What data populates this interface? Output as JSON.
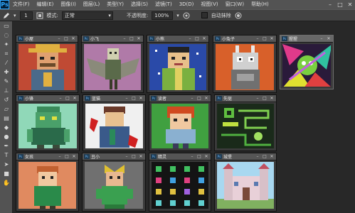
{
  "app": {
    "logo": "Ps"
  },
  "menu": [
    "文件(F)",
    "编辑(E)",
    "图像(I)",
    "图层(L)",
    "类型(Y)",
    "选择(S)",
    "滤镜(T)",
    "3D(D)",
    "视图(V)",
    "窗口(W)",
    "帮助(H)"
  ],
  "window_controls": {
    "minimize": "–",
    "restore": "□",
    "close": "✕"
  },
  "options": {
    "size": "1",
    "mode_label": "模式:",
    "mode_value": "正常",
    "opacity_label": "不透明度:",
    "opacity_value": "100%",
    "autoerase_label": "自动抹除"
  },
  "tools": [
    "select-icon",
    "lasso-icon",
    "magic-wand-icon",
    "crop-icon",
    "eyedropper-icon",
    "healing-icon",
    "pencil-icon",
    "stamp-icon",
    "history-brush-icon",
    "eraser-icon",
    "gradient-icon",
    "blur-icon",
    "dodge-icon",
    "pen-icon",
    "text-icon",
    "path-select-icon",
    "shape-icon",
    "hand-icon"
  ],
  "documents": [
    {
      "title": "小屋"
    },
    {
      "title": "小飞"
    },
    {
      "title": "小熊"
    },
    {
      "title": "小兔子"
    },
    {
      "title": "猩猩"
    },
    {
      "title": "小锋"
    },
    {
      "title": "蓝猫"
    },
    {
      "title": "读者"
    },
    {
      "title": "先驱"
    },
    {
      "title": "女孩"
    },
    {
      "title": "丑小"
    },
    {
      "title": "精灵"
    },
    {
      "title": "城堡"
    }
  ],
  "colors": {
    "accent": "#31a8ff",
    "panel": "#535353",
    "workspace": "#282828"
  }
}
